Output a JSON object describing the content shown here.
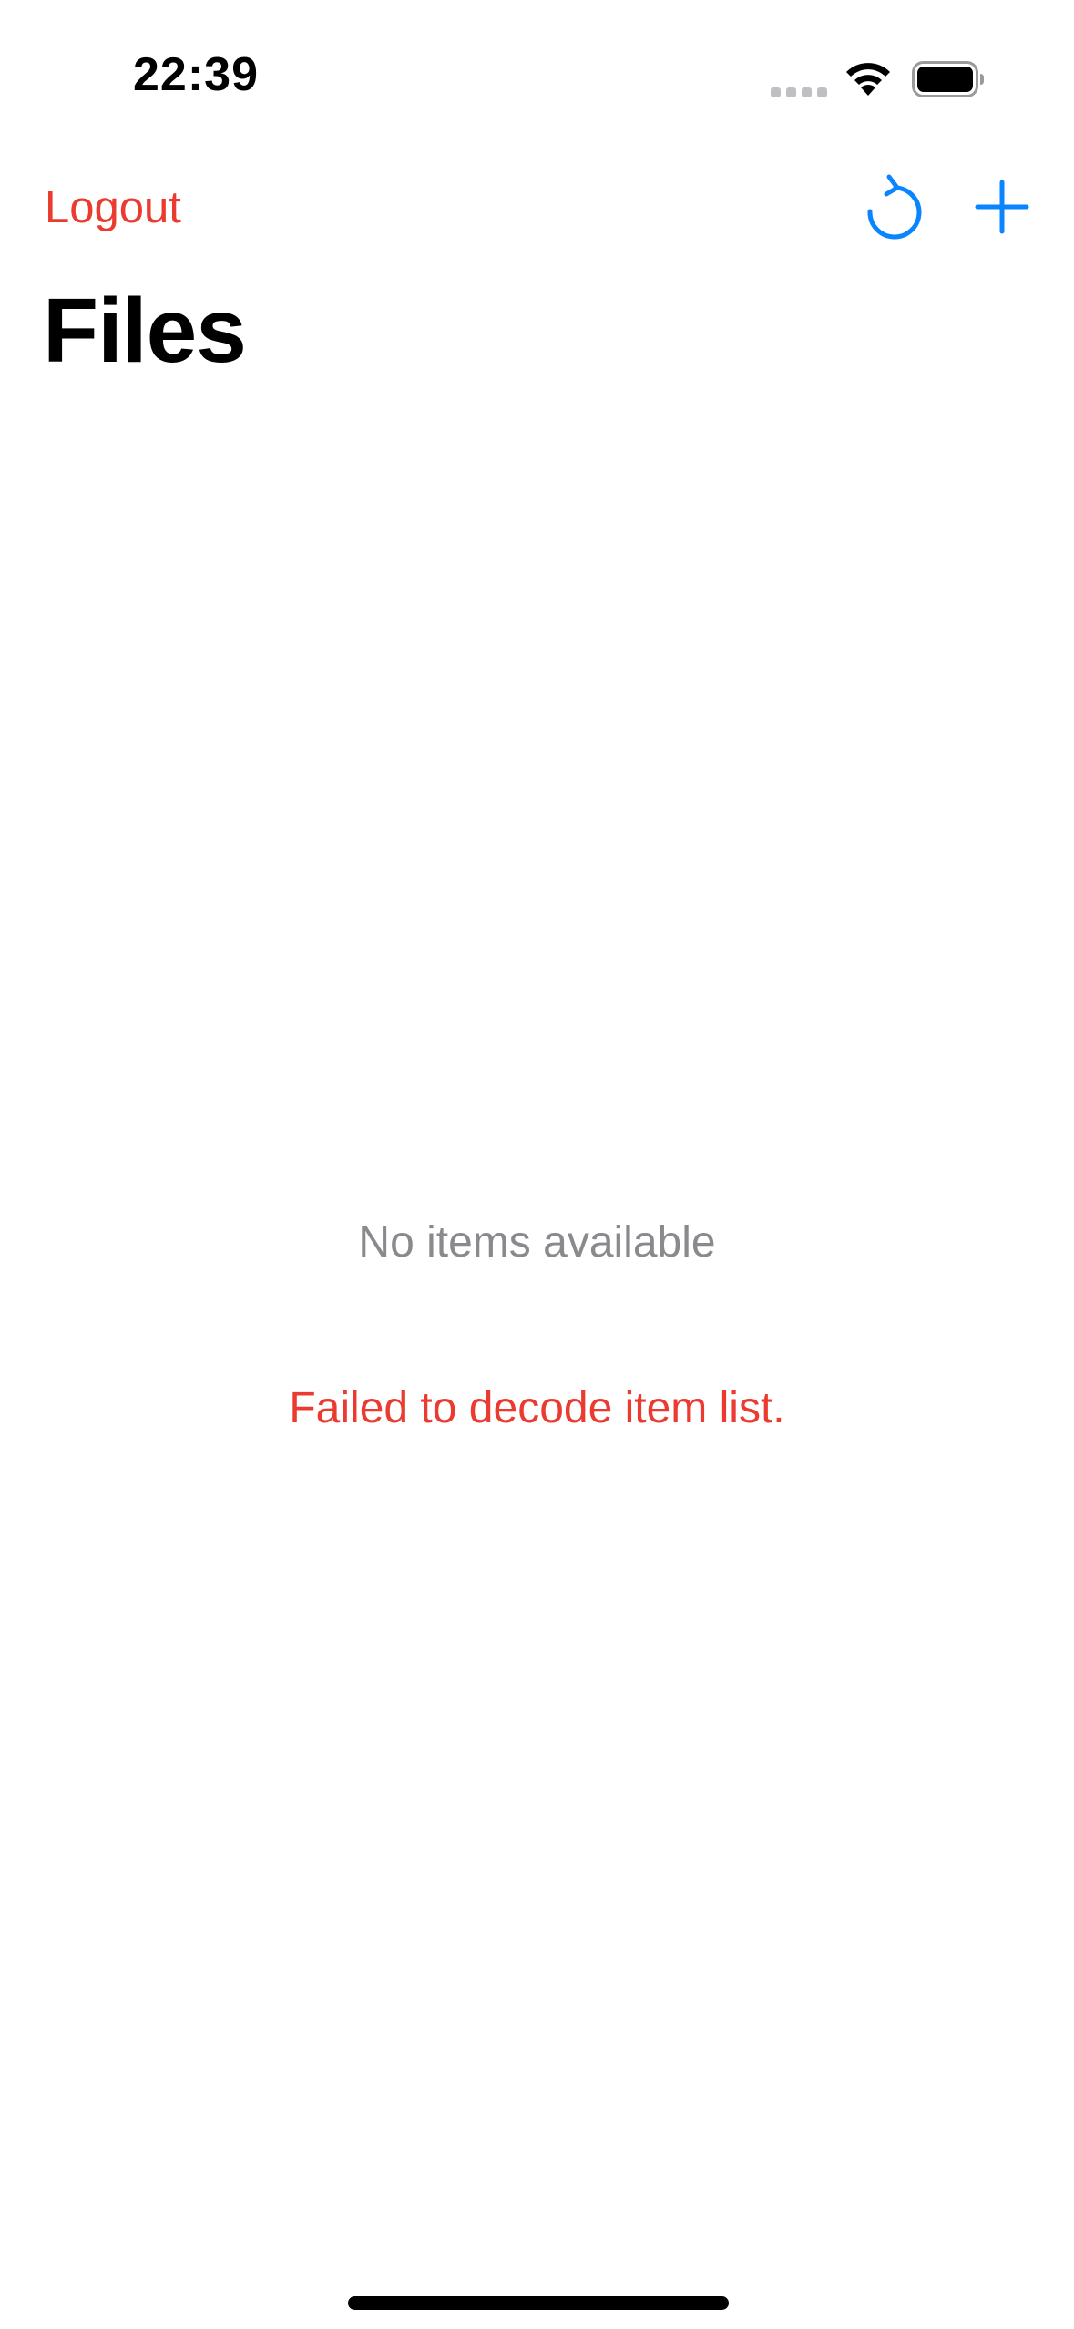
{
  "status_bar": {
    "time": "22:39",
    "icons": [
      "cellular-signal-icon",
      "wifi-icon",
      "battery-icon"
    ]
  },
  "nav": {
    "logout_label": "Logout",
    "title": "Files",
    "actions": [
      "refresh-icon",
      "plus-icon"
    ]
  },
  "content": {
    "empty_message": "No items available",
    "error_message": "Failed to decode item list."
  },
  "colors": {
    "accent_blue": "#0A84FF",
    "destructive_red": "#EB3B30",
    "secondary_gray": "#8A8A8E",
    "background": "#FFFFFF"
  }
}
